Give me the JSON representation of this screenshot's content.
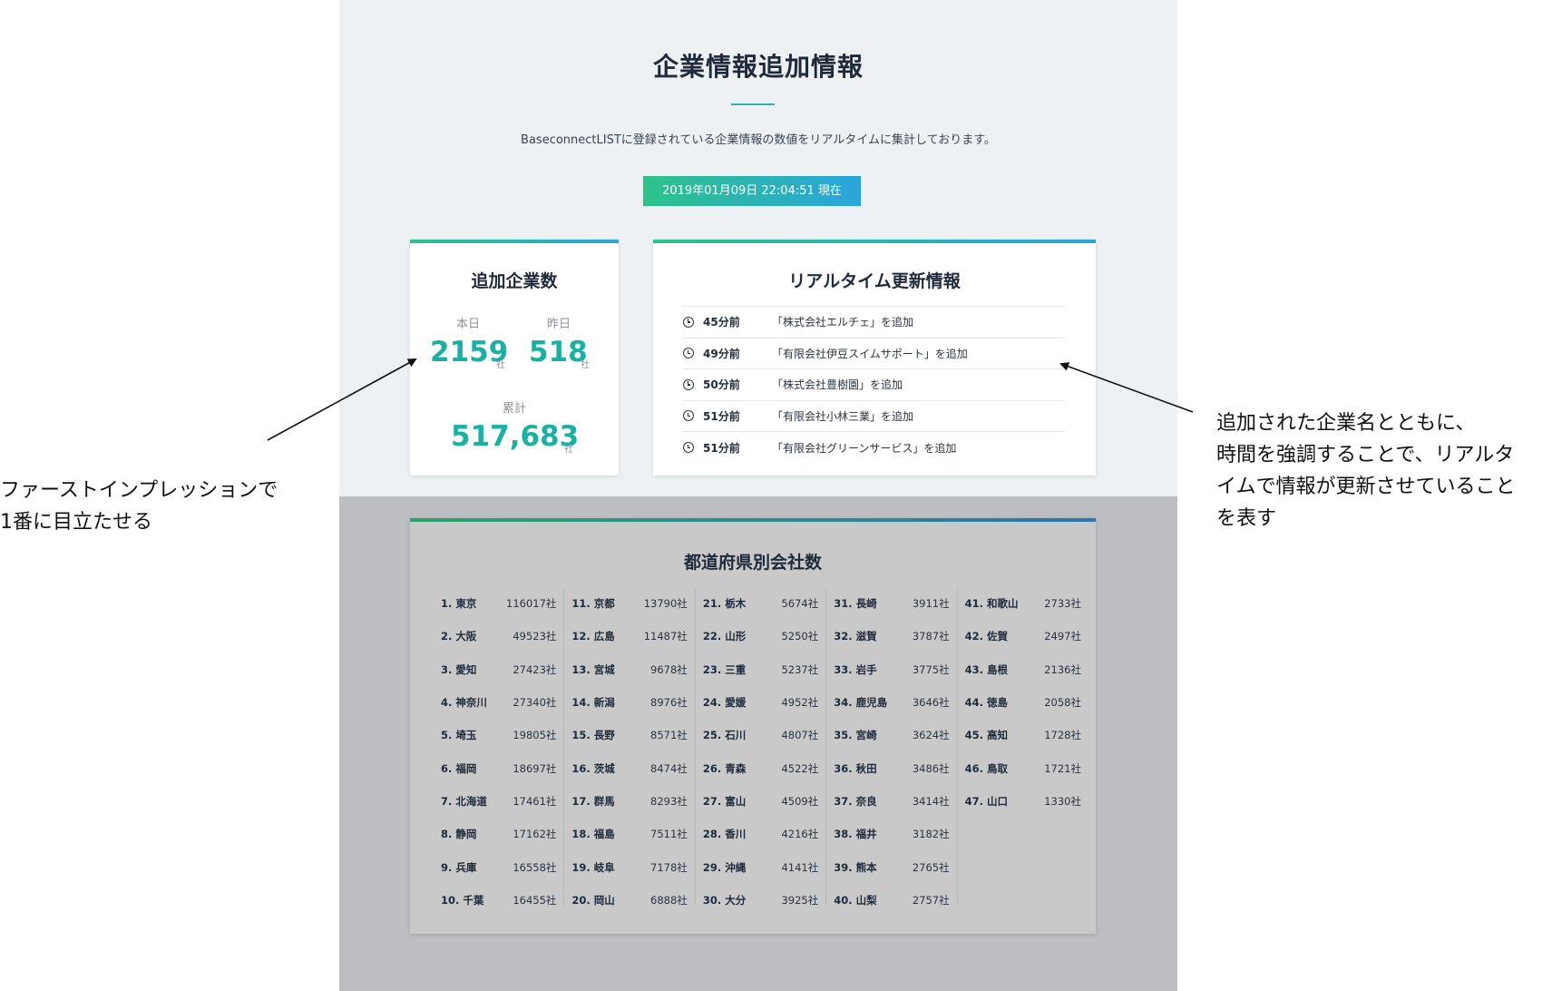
{
  "header": {
    "title": "企業情報追加情報",
    "subtitle": "BaseconnectLISTに登録されている企業情報の数値をリアルタイムに集計しております。",
    "timestamp": "2019年01月09日 22:04:51 現在"
  },
  "added_card": {
    "title": "追加企業数",
    "today_label": "本日",
    "today_value": "2159",
    "yesterday_label": "昨日",
    "yesterday_value": "518",
    "total_label": "累計",
    "total_value": "517,683",
    "unit": "社"
  },
  "realtime_card": {
    "title": "リアルタイム更新情報",
    "items": [
      {
        "time": "45分前",
        "text": "「株式会社エルチェ」を追加"
      },
      {
        "time": "49分前",
        "text": "「有限会社伊豆スイムサポート」を追加"
      },
      {
        "time": "50分前",
        "text": "「株式会社豊樹園」を追加"
      },
      {
        "time": "51分前",
        "text": "「有限会社小林三業」を追加"
      },
      {
        "time": "51分前",
        "text": "「有限会社グリーンサービス」を追加"
      }
    ]
  },
  "prefecture_card": {
    "title": "都道府県別会社数",
    "columns": [
      [
        {
          "name": "1. 東京",
          "count": "116017社"
        },
        {
          "name": "2. 大阪",
          "count": "49523社"
        },
        {
          "name": "3. 愛知",
          "count": "27423社"
        },
        {
          "name": "4. 神奈川",
          "count": "27340社"
        },
        {
          "name": "5. 埼玉",
          "count": "19805社"
        },
        {
          "name": "6. 福岡",
          "count": "18697社"
        },
        {
          "name": "7. 北海道",
          "count": "17461社"
        },
        {
          "name": "8. 静岡",
          "count": "17162社"
        },
        {
          "name": "9. 兵庫",
          "count": "16558社"
        },
        {
          "name": "10. 千葉",
          "count": "16455社"
        }
      ],
      [
        {
          "name": "11. 京都",
          "count": "13790社"
        },
        {
          "name": "12. 広島",
          "count": "11487社"
        },
        {
          "name": "13. 宮城",
          "count": "9678社"
        },
        {
          "name": "14. 新潟",
          "count": "8976社"
        },
        {
          "name": "15. 長野",
          "count": "8571社"
        },
        {
          "name": "16. 茨城",
          "count": "8474社"
        },
        {
          "name": "17. 群馬",
          "count": "8293社"
        },
        {
          "name": "18. 福島",
          "count": "7511社"
        },
        {
          "name": "19. 岐阜",
          "count": "7178社"
        },
        {
          "name": "20. 岡山",
          "count": "6888社"
        }
      ],
      [
        {
          "name": "21. 栃木",
          "count": "5674社"
        },
        {
          "name": "22. 山形",
          "count": "5250社"
        },
        {
          "name": "23. 三重",
          "count": "5237社"
        },
        {
          "name": "24. 愛媛",
          "count": "4952社"
        },
        {
          "name": "25. 石川",
          "count": "4807社"
        },
        {
          "name": "26. 青森",
          "count": "4522社"
        },
        {
          "name": "27. 富山",
          "count": "4509社"
        },
        {
          "name": "28. 香川",
          "count": "4216社"
        },
        {
          "name": "29. 沖縄",
          "count": "4141社"
        },
        {
          "name": "30. 大分",
          "count": "3925社"
        }
      ],
      [
        {
          "name": "31. 長崎",
          "count": "3911社"
        },
        {
          "name": "32. 滋賀",
          "count": "3787社"
        },
        {
          "name": "33. 岩手",
          "count": "3775社"
        },
        {
          "name": "34. 鹿児島",
          "count": "3646社"
        },
        {
          "name": "35. 宮崎",
          "count": "3624社"
        },
        {
          "name": "36. 秋田",
          "count": "3486社"
        },
        {
          "name": "37. 奈良",
          "count": "3414社"
        },
        {
          "name": "38. 福井",
          "count": "3182社"
        },
        {
          "name": "39. 熊本",
          "count": "2765社"
        },
        {
          "name": "40. 山梨",
          "count": "2757社"
        }
      ],
      [
        {
          "name": "41. 和歌山",
          "count": "2733社"
        },
        {
          "name": "42. 佐賀",
          "count": "2497社"
        },
        {
          "name": "43. 島根",
          "count": "2136社"
        },
        {
          "name": "44. 徳島",
          "count": "2058社"
        },
        {
          "name": "45. 高知",
          "count": "1728社"
        },
        {
          "name": "46. 鳥取",
          "count": "1721社"
        },
        {
          "name": "47. 山口",
          "count": "1330社"
        }
      ]
    ]
  },
  "annotations": {
    "left_line1": "ファーストインプレッションで",
    "left_line2": "1番に目立たせる",
    "right_line1": "追加された企業名とともに、",
    "right_line2": "時間を強調することで、リアルタ",
    "right_line3": "イムで情報が更新させていること",
    "right_line4": "を表す"
  }
}
